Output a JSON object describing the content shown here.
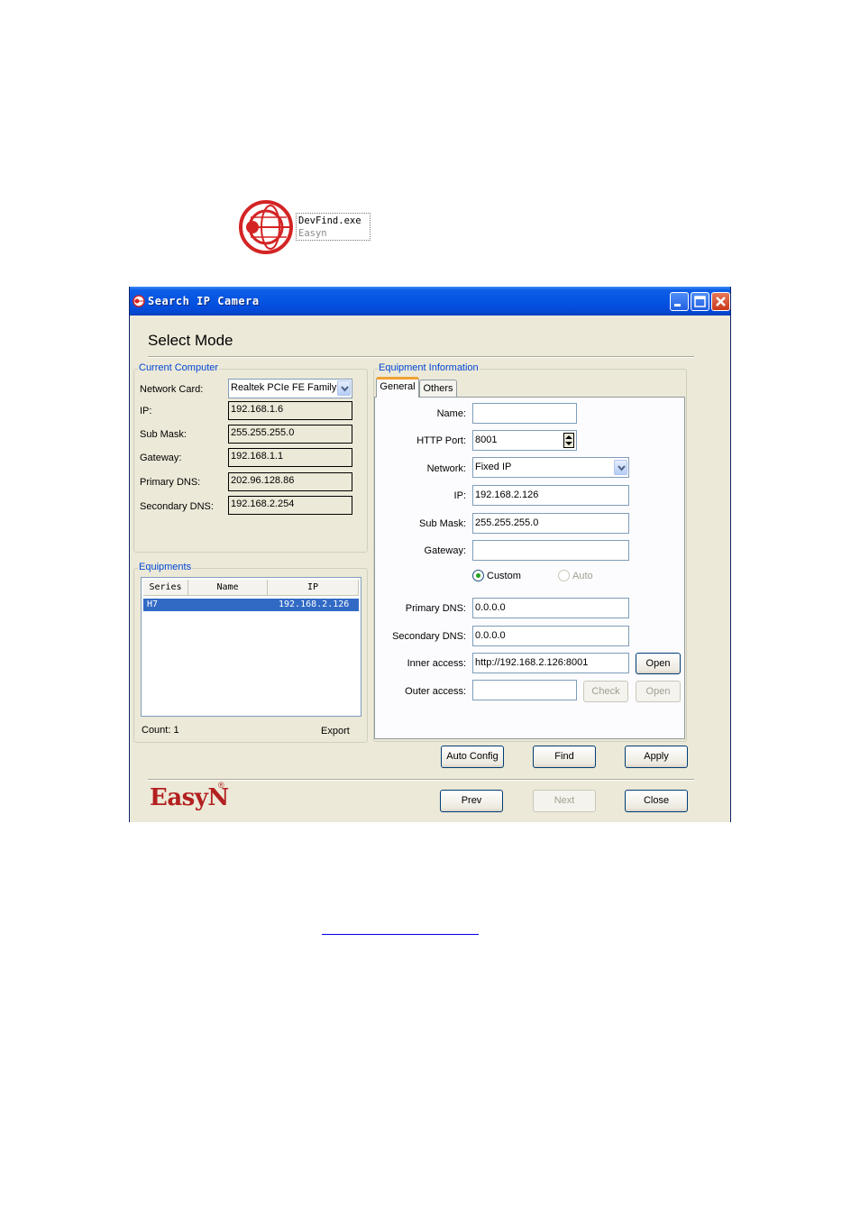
{
  "shortcut": {
    "line1": "DevFind.exe",
    "line2": "Easyn"
  },
  "window": {
    "title": "Search IP Camera"
  },
  "header": {
    "title": "Select Mode"
  },
  "current_computer": {
    "legend": "Current Computer",
    "network_card_label": "Network Card:",
    "network_card_value": "Realtek PCIe FE Family C",
    "ip_label": "IP:",
    "ip_value": "192.168.1.6",
    "submask_label": "Sub Mask:",
    "submask_value": "255.255.255.0",
    "gateway_label": "Gateway:",
    "gateway_value": "192.168.1.1",
    "primary_dns_label": "Primary DNS:",
    "primary_dns_value": "202.96.128.86",
    "secondary_dns_label": "Secondary DNS:",
    "secondary_dns_value": "192.168.2.254"
  },
  "equipments": {
    "legend": "Equipments",
    "columns": [
      "Series",
      "Name",
      "IP"
    ],
    "rows": [
      {
        "series": "H7",
        "name": "",
        "ip": "192.168.2.126"
      }
    ],
    "count_label": "Count: 1",
    "export_label": "Export"
  },
  "equipment_info": {
    "legend": "Equipment Information",
    "tabs": [
      "General",
      "Others"
    ],
    "name_label": "Name:",
    "name_value": "",
    "http_port_label": "HTTP Port:",
    "http_port_value": "8001",
    "network_label": "Network:",
    "network_value": "Fixed IP",
    "ip_label": "IP:",
    "ip_value": "192.168.2.126",
    "submask_label": "Sub Mask:",
    "submask_value": "255.255.255.0",
    "gateway_label": "Gateway:",
    "gateway_value": "",
    "dns_mode": {
      "custom": "Custom",
      "auto": "Auto",
      "selected": "custom"
    },
    "primary_dns_label": "Primary DNS:",
    "primary_dns_value": "0.0.0.0",
    "secondary_dns_label": "Secondary DNS:",
    "secondary_dns_value": "0.0.0.0",
    "inner_access_label": "Inner access:",
    "inner_access_value": "http://192.168.2.126:8001",
    "outer_access_label": "Outer access:",
    "outer_access_value": "",
    "open_label": "Open",
    "check_label": "Check"
  },
  "actions": {
    "auto_config": "Auto Config",
    "find": "Find",
    "apply": "Apply"
  },
  "footer": {
    "brand": "EasyN",
    "reg": "®",
    "prev": "Prev",
    "next": "Next",
    "close": "Close"
  },
  "icons": {
    "app": "globe-target-icon",
    "minimize": "minimize-icon",
    "maximize": "maximize-icon",
    "close": "close-icon"
  },
  "colors": {
    "titlebar": "#0554e3",
    "legend": "#0046d5",
    "selection": "#316ac5",
    "brand": "#b32020"
  }
}
